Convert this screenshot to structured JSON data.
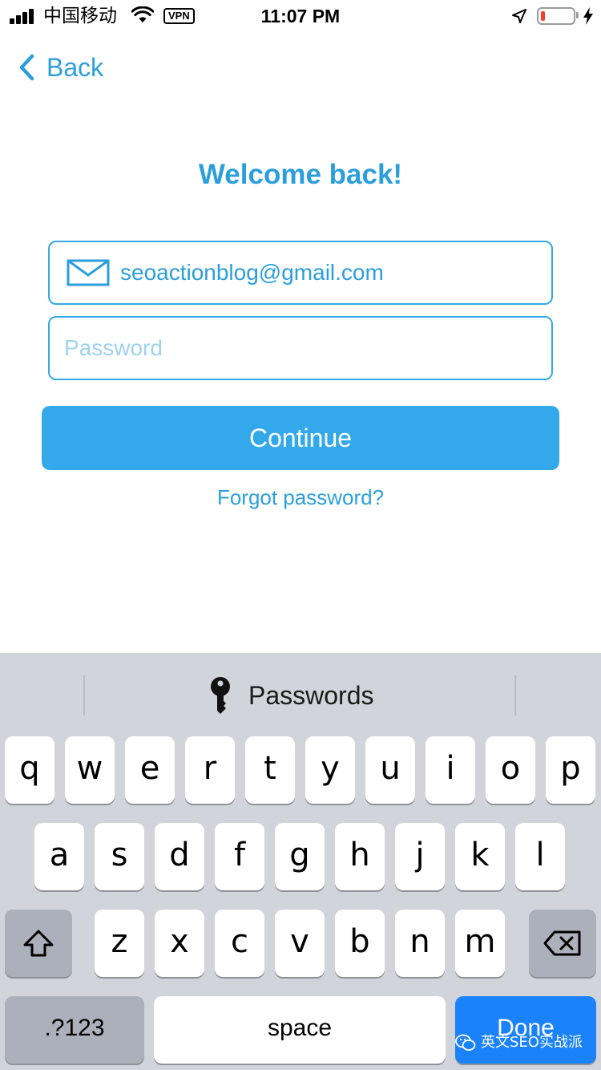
{
  "status_bar": {
    "carrier": "中国移动",
    "vpn": "VPN",
    "time": "11:07 PM",
    "battery_level_fraction": 0.12,
    "battery_color": "#ff3b30",
    "icons": [
      "signal-icon",
      "wifi-icon",
      "location-arrow-icon",
      "battery-icon",
      "charging-bolt-icon"
    ]
  },
  "nav": {
    "back_label": "Back"
  },
  "main": {
    "title": "Welcome back!",
    "email_value": "seoactionblog@gmail.com",
    "password_placeholder": "Password",
    "continue_label": "Continue",
    "forgot_label": "Forgot password?"
  },
  "keyboard": {
    "suggestion_label": "Passwords",
    "row1": [
      "q",
      "w",
      "e",
      "r",
      "t",
      "y",
      "u",
      "i",
      "o",
      "p"
    ],
    "row2": [
      "a",
      "s",
      "d",
      "f",
      "g",
      "h",
      "j",
      "k",
      "l"
    ],
    "row3": [
      "z",
      "x",
      "c",
      "v",
      "b",
      "n",
      "m"
    ],
    "numbers_label": ".?123",
    "space_label": "space",
    "done_label": "Done"
  },
  "watermark": {
    "text": "英文SEO实战派"
  },
  "colors": {
    "accent": "#2b9fdc",
    "button": "#33a9ec",
    "done_key": "#1a82fb",
    "keyboard_bg": "#d1d4da"
  }
}
